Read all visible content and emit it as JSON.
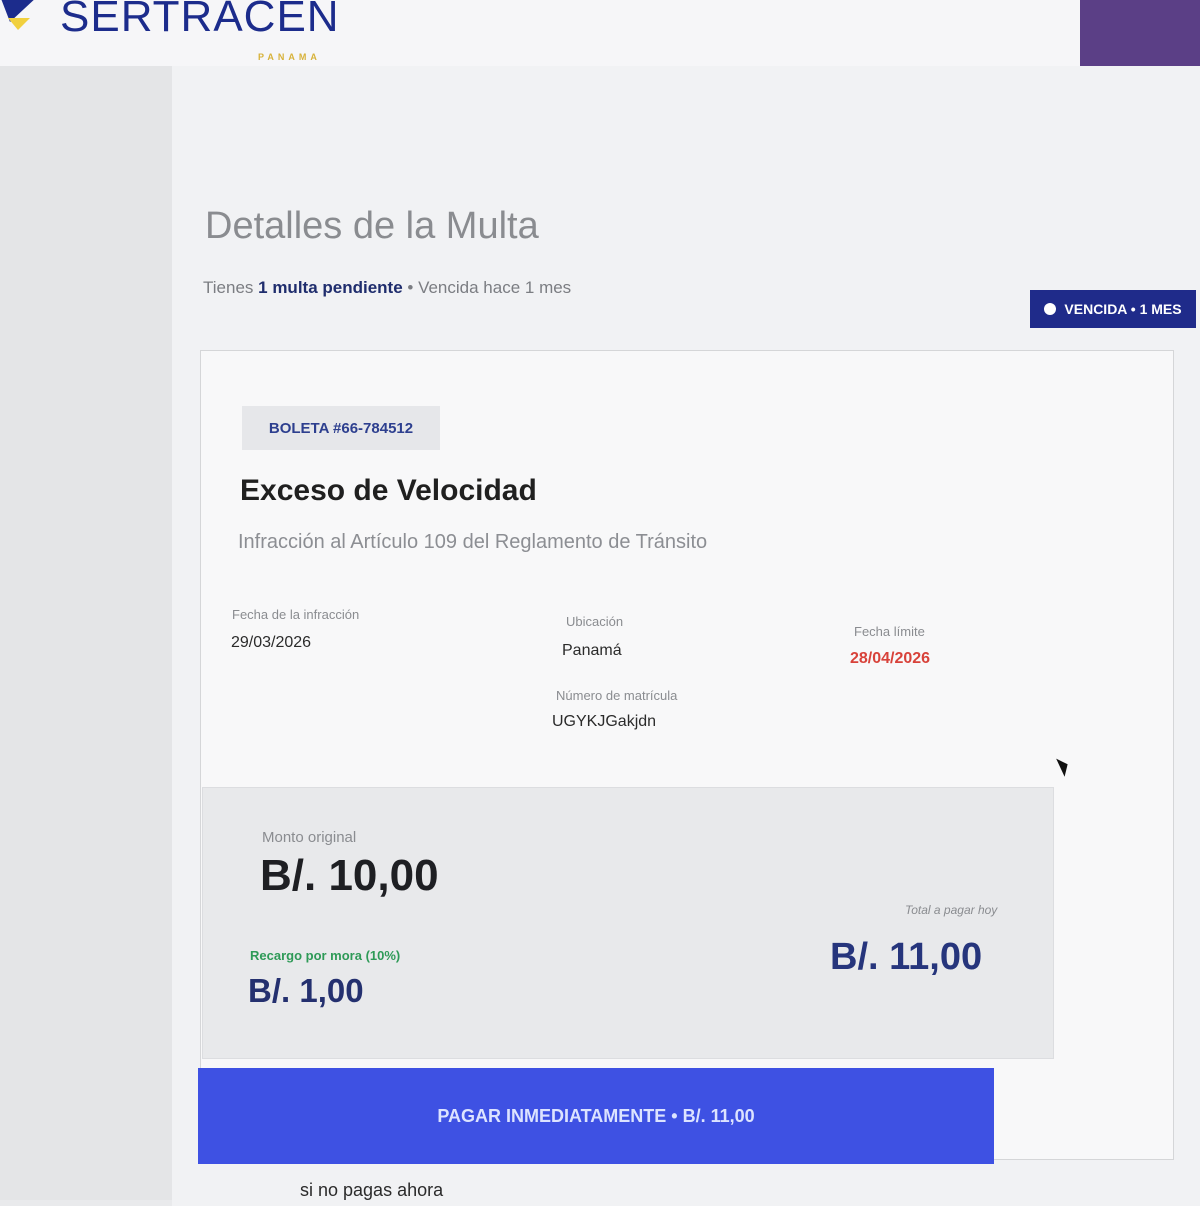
{
  "brand": {
    "name": "SERTRACEN",
    "subtitle": "PANAMA"
  },
  "page": {
    "title": "Detalles de la Multa",
    "summary_prefix": "Tienes",
    "summary_count": "1 multa pendiente",
    "summary_suffix": "• Vencida hace 1 mes",
    "status_badge": "VENCIDA • 1 MES"
  },
  "ticket": {
    "number": "BOLETA #66-784512",
    "title": "Exceso de Velocidad",
    "subtitle": "Infracción al Artículo 109 del Reglamento de Tránsito"
  },
  "details": {
    "infraction_date_label": "Fecha de la infracción",
    "infraction_date": "29/03/2026",
    "location_label": "Ubicación",
    "location": "Panamá",
    "deadline_label": "Fecha límite",
    "deadline": "28/04/2026",
    "plate_label": "Número de matrícula",
    "plate": "UGYKJGakjdn"
  },
  "amounts": {
    "original_label": "Monto original",
    "original": "B/. 10,00",
    "surcharge_label": "Recargo por mora (10%)",
    "surcharge": "B/. 1,00",
    "total_label": "Total a pagar hoy",
    "total": "B/. 11,00"
  },
  "actions": {
    "pay_now": "PAGAR INMEDIATAMENTE • B/. 11,00"
  },
  "footer": {
    "text": "si no pagas ahora"
  },
  "colors": {
    "primary": "#3e51e3",
    "navy": "#1f2b8a",
    "danger": "#d8423a",
    "success": "#2e9a57"
  }
}
